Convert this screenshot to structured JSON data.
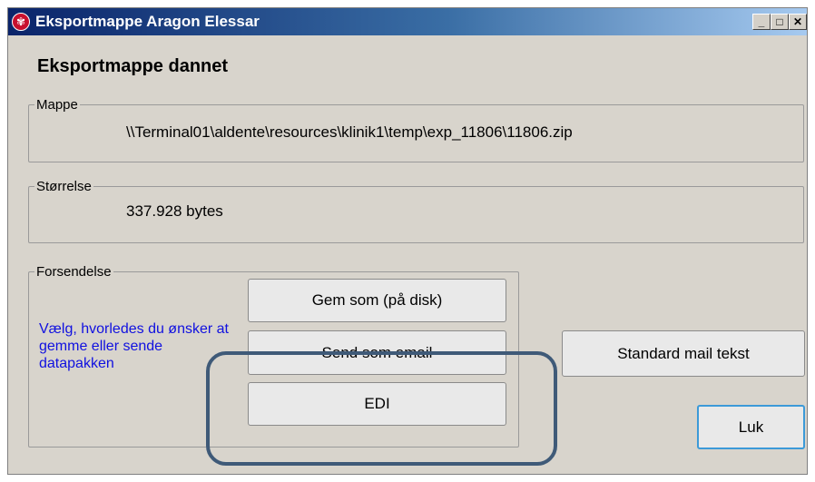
{
  "window": {
    "title": "Eksportmappe  Aragon Elessar",
    "controls": {
      "minimize": "_",
      "maximize": "□",
      "close": "✕"
    }
  },
  "heading": "Eksportmappe dannet",
  "mappe": {
    "legend": "Mappe",
    "path": "\\\\Terminal01\\aldente\\resources\\klinik1\\temp\\exp_11806\\11806.zip"
  },
  "size": {
    "legend": "Størrelse",
    "value": "337.928 bytes"
  },
  "forsendelse": {
    "legend": "Forsendelse",
    "instruction": "Vælg, hvorledes du ønsker at gemme eller sende datapakken",
    "buttons": {
      "save": "Gem som (på disk)",
      "email": "Send som email",
      "edi": "EDI"
    }
  },
  "standard_mail_button": "Standard mail tekst",
  "close_button": "Luk",
  "colors": {
    "instruction_text": "#1010e0",
    "highlight_outline": "#3f5a78",
    "title_gradient_start": "#0a246a",
    "title_gradient_end": "#a6caf0"
  },
  "icons": {
    "app": "app-logo-icon"
  }
}
